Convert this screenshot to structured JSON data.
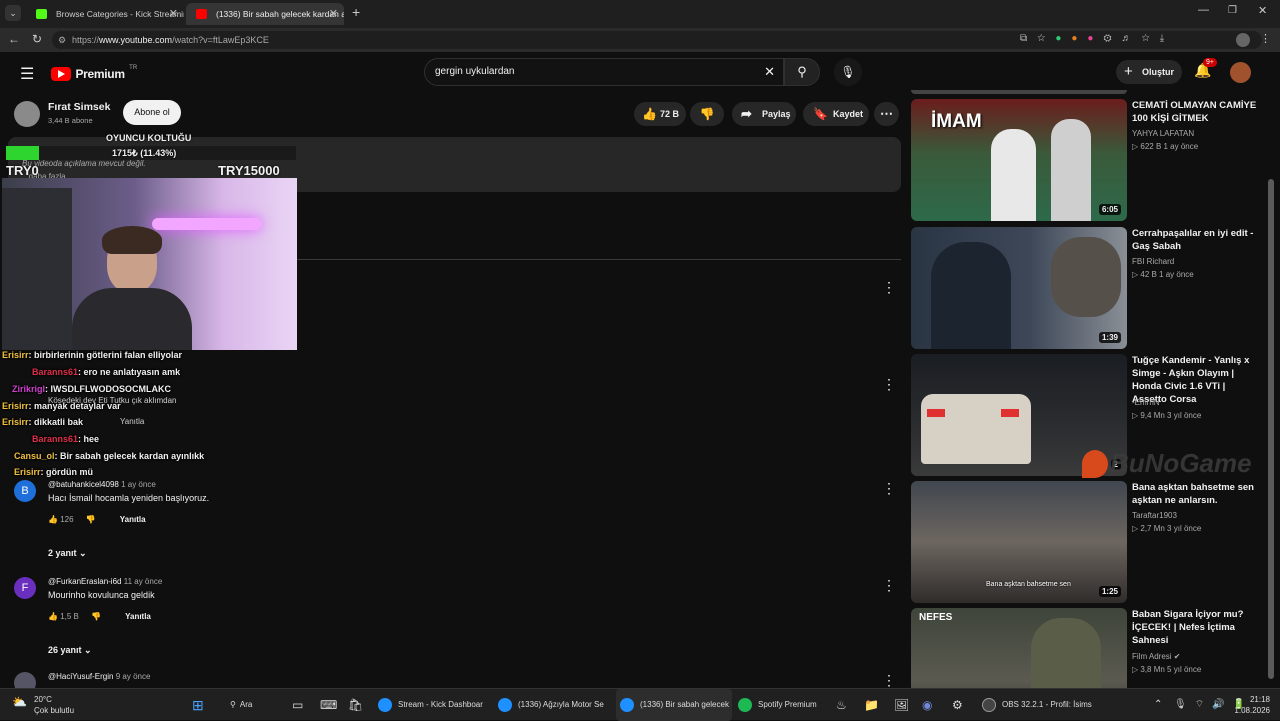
{
  "browser": {
    "tabs": [
      {
        "title": "Browse Categories - Kick Streamin",
        "active": false
      },
      {
        "title": "(1336) Bir sabah gelecek kardan a",
        "active": true
      }
    ],
    "url_prefix": "https://",
    "url_host": "www.youtube.com",
    "url_path": "/watch?v=ftLawEp3KCE"
  },
  "header": {
    "logo": "Premium",
    "country": "TR",
    "search_value": "gergin uykulardan",
    "create_label": "Oluştur",
    "notif_badge": "9+"
  },
  "channel": {
    "name": "Fırat Simsek",
    "subs": "3,44 B abone",
    "subscribe_label": "Abone ol",
    "likes": "72 B",
    "share_label": "Paylaş",
    "save_label": "Kaydet"
  },
  "description": {
    "text": "Bu videoda açıklama mevcut değil.",
    "more": "...daha fazla"
  },
  "overlay": {
    "goal_title": "OYUNCU KOLTUĞU",
    "goal_progress_text": "1715₺ (11.43%)",
    "goal_fraction": 0.1143,
    "min_label": "TRY0",
    "max_label": "TRY15000",
    "chat": [
      {
        "user": "Erisirr",
        "msg": ": birbirlerinin götlerini falan elliyolar",
        "color": "#f0c040"
      },
      {
        "user": "Baranns61",
        "msg": ": ero ne anlatıyasın amk",
        "color": "#e0304a"
      },
      {
        "user": "Zirikrigl",
        "msg": ": IWSDLFLWODOSOCMLAKC",
        "color": "#d040d0"
      },
      {
        "user": "Erisirr",
        "msg": ": manyak detaylar var",
        "color": "#f0c040"
      },
      {
        "user": "Erisirr",
        "msg": ": dikkatli bak",
        "color": "#f0c040"
      },
      {
        "user": "Baranns61",
        "msg": ": hee",
        "color": "#e0304a"
      },
      {
        "user": "Cansu_ol",
        "msg": ": Bir sabah gelecek kardan ayınlıkk",
        "color": "#f0c040"
      },
      {
        "user": "Erisirr",
        "msg": ": gördün mü",
        "color": "#f0c040"
      }
    ]
  },
  "comments": [
    {
      "user": "@batuhankicel4098",
      "time": "1 ay önce",
      "text": "Hacı İsmail hocamla yeniden başlıyoruz.",
      "likes": "126",
      "reply": "Yanıtla",
      "replies": "2 yanıt",
      "avatar": "B",
      "avatar_color": "#1e6fd9"
    },
    {
      "user": "@FurkanEraslan-i6d",
      "time": "11 ay önce",
      "text": "Mourinho kovulunca geldik",
      "likes": "1,5 B",
      "reply": "Yanıtla",
      "replies": "26 yanıt",
      "avatar": "F",
      "avatar_color": "#6a2fbf"
    },
    {
      "user": "@HaciYusuf-Ergin",
      "time": "9 ay önce",
      "text": "",
      "likes": "",
      "reply": "",
      "replies": "",
      "avatar": "",
      "avatar_color": "#555"
    }
  ],
  "hidden_comment": {
    "text": "Köşedeki dev Eti Tutku çık aklımdan",
    "reply": "Yanıtla"
  },
  "related": [
    {
      "title": "CEMATİ OLMAYAN CAMİYE 100 KİŞİ GİTMEK",
      "channel": "YAHYA LAFATAN",
      "meta": "▷ 622 B   1 ay önce",
      "duration": "6:05",
      "thumb_text": "İMAM"
    },
    {
      "title": "Cerrahpaşalılar en iyi edit - Gaş Sabah",
      "channel": "FBI Richard",
      "meta": "▷ 42 B   1 ay önce",
      "duration": "1:39",
      "thumb_text": ""
    },
    {
      "title": "Tuğçe Kandemir - Yanlış x Simge - Aşkın Olayım | Honda Civic 1.6 VTi | Assetto Corsa",
      "channel": "-EmrhN",
      "meta": "▷ 9,4 Mn   3 yıl önce",
      "duration": "2",
      "thumb_text": ""
    },
    {
      "title": "Bana aşktan bahsetme sen aşktan ne anlarsın.",
      "channel": "Taraftar1903",
      "meta": "▷ 2,7 Mn   3 yıl önce",
      "duration": "1:25",
      "thumb_text": "Bana aşktan bahsetme sen"
    },
    {
      "title": "Baban Sigara İçiyor mu? İÇECEK! | Nefes İçtima Sahnesi",
      "channel": "Film Adresi",
      "meta": "▷ 3,8 Mn   5 yıl önce",
      "duration": "",
      "thumb_text": "NEFES"
    }
  ],
  "watermark": "BuNoGame",
  "taskbar": {
    "weather_temp": "20°C",
    "weather_text": "Çok bulutlu",
    "search": "Ara",
    "apps": [
      {
        "label": "Stream - Kick Dashboar",
        "color": "#1e90ff"
      },
      {
        "label": "(1336) Ağzıyla Motor Se",
        "color": "#1e90ff"
      },
      {
        "label": "(1336) Bir sabah gelecek",
        "color": "#1e90ff"
      },
      {
        "label": "Spotify Premium",
        "color": "#1db954"
      },
      {
        "label": "OBS 32.2.1 - Profil: İsims",
        "color": "#444"
      }
    ],
    "time": "21:18",
    "date": "1.08.2026"
  }
}
